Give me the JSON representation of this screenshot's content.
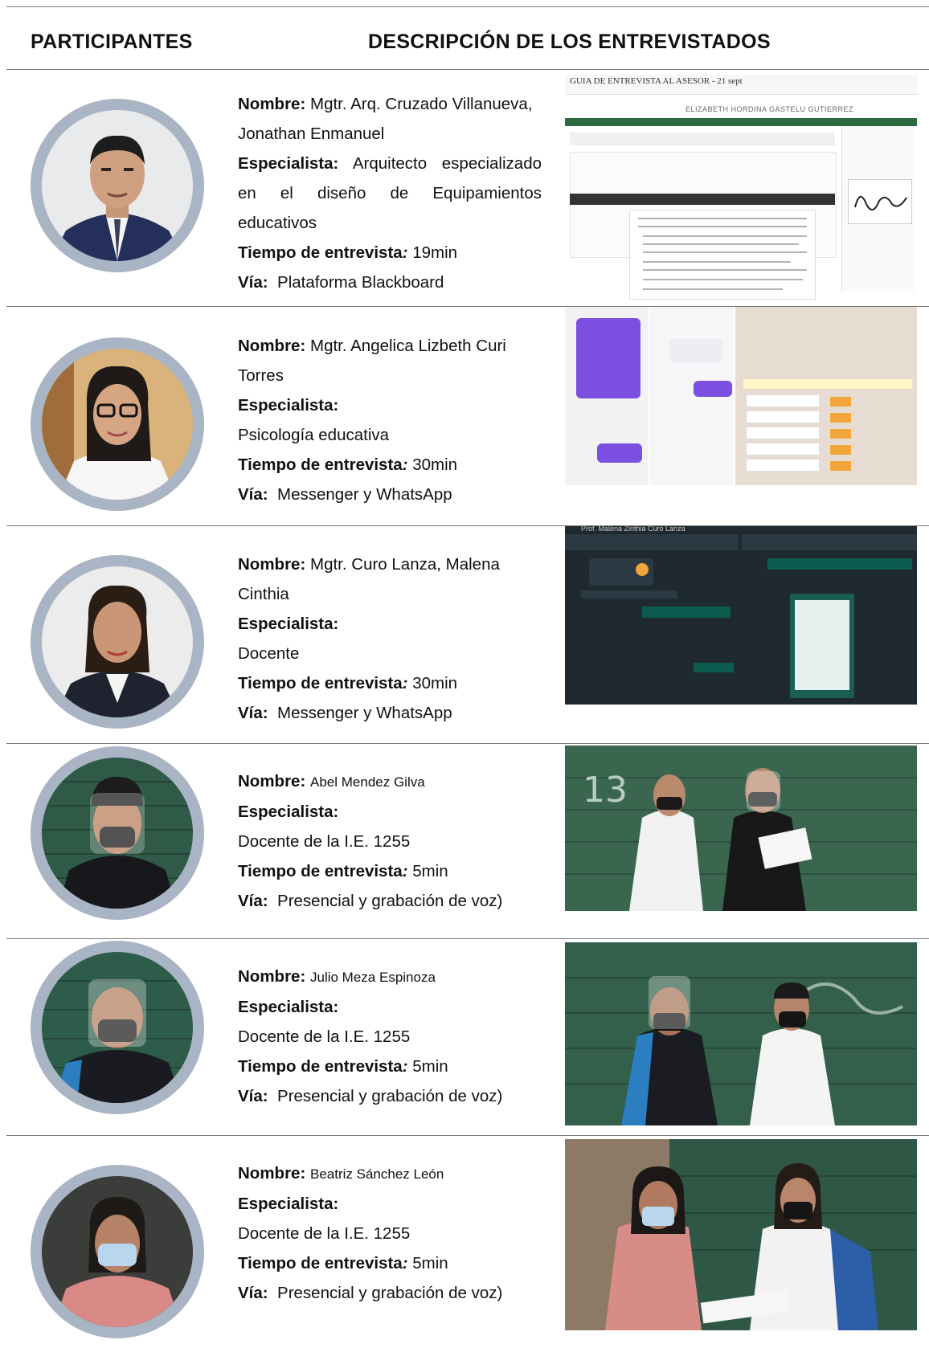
{
  "header": {
    "col1": "PARTICIPANTES",
    "col2": "DESCRIPCIÓN DE LOS ENTREVISTADOS"
  },
  "labels": {
    "nombre": "Nombre:",
    "especialista": "Especialista:",
    "tiempo": "Tiempo de entrevista",
    "tiempo_colon": ":",
    "via": "Vía:"
  },
  "participants": [
    {
      "name_line1": "Mgtr. Arq. Cruzado Villanueva,",
      "name_line2": "Jonathan Enmanuel",
      "specialty_inline": "Arquitecto especializado en el diseño de Equipamientos educativos",
      "time": "19min",
      "via": "Plataforma Blackboard",
      "image": {
        "kind": "screenshot-document",
        "header_small": "GUIA DE ENTREVISTA AL ASESOR - 21 sept",
        "title": "ELIZABETH HORDINA GASTELU GUTIERREZ"
      }
    },
    {
      "name_line1": "Mgtr. Angelica Lizbeth Curi",
      "name_line2": "Torres",
      "specialty": "Psicología educativa",
      "time": "30min",
      "via": "Messenger y WhatsApp",
      "image": {
        "kind": "screenshot-chat-light"
      }
    },
    {
      "name_line1": "Mgtr. Curo Lanza, Malena",
      "name_line2": "Cinthia",
      "specialty": "Docente",
      "time": "30min",
      "via": "Messenger y WhatsApp",
      "image": {
        "kind": "screenshot-chat-dark",
        "header_small": "Prof. Malena Zinthia Curo Lanza"
      }
    },
    {
      "name": "Abel Mendez Gilva",
      "specialty": "Docente de la I.E. 1255",
      "time": "5min",
      "via": "Presencial y grabación de voz)",
      "image": {
        "kind": "photo-green-wall",
        "wall_mark": "13"
      }
    },
    {
      "name": "Julio Meza Espinoza",
      "specialty": "Docente de la I.E. 1255",
      "time": "5min",
      "via": "Presencial y grabación de voz)",
      "image": {
        "kind": "photo-green-wall"
      }
    },
    {
      "name": "Beatriz Sánchez León",
      "specialty": "Docente de la I.E. 1255",
      "time": "5min",
      "via": "Presencial y grabación de voz)",
      "image": {
        "kind": "photo-green-wall"
      }
    }
  ],
  "colors": {
    "avatar_ring": "#a9b4c4",
    "rule": "#7a7a7a",
    "wall_green": "#2f5a48",
    "chat_dark": "#1e2a30"
  }
}
